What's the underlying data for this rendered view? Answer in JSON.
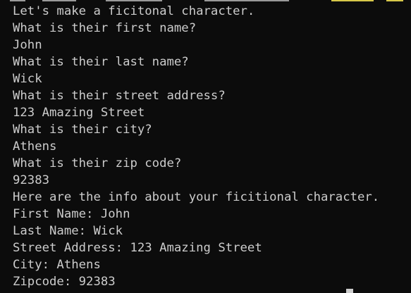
{
  "terminal": {
    "lines": [
      "Let's make a ficitonal character.",
      "What is their first name?",
      "John",
      "What is their last name?",
      "Wick",
      "What is their street address?",
      "123 Amazing Street",
      "What is their city?",
      "Athens",
      "What is their zip code?",
      "92383",
      "Here are the info about your ficitional character.",
      "First Name: John",
      "Last Name: Wick",
      "Street Address: 123 Amazing Street",
      "City: Athens",
      "Zipcode: 92383"
    ]
  },
  "colors": {
    "background": "#0c0c0c",
    "foreground": "#cccccc",
    "accent": "#d7c84a"
  }
}
